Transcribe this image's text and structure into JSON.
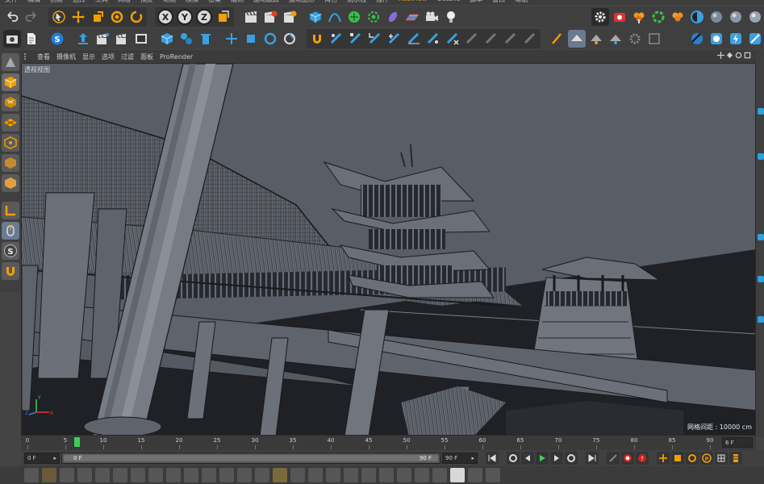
{
  "menubar": {
    "items": [
      "文件",
      "编辑",
      "创建",
      "选择",
      "工具",
      "网格",
      "捕捉",
      "动画",
      "模拟",
      "渲染",
      "雕刻",
      "运动跟踪",
      "运动图形",
      "角色",
      "流水线",
      "插件",
      "RealFlow",
      "Octane",
      "脚本",
      "窗口",
      "帮助"
    ],
    "highlight_index": 16
  },
  "viewport": {
    "menu": [
      "查看",
      "摄像机",
      "显示",
      "选项",
      "过滤",
      "面板",
      "ProRender"
    ],
    "label": "透视视图",
    "grid_readout": "网格间距 : 10000 cm",
    "colors": {
      "sky": "#585d66",
      "ground": "#1f2126",
      "geometry": "#6b7079",
      "wire": "#1a1a1a"
    }
  },
  "timeline": {
    "ticks": [
      0,
      5,
      10,
      15,
      20,
      25,
      30,
      35,
      40,
      45,
      50,
      55,
      60,
      65,
      70,
      75,
      80,
      85,
      90
    ],
    "current_frame": 6,
    "end_frame_label": "6 F",
    "max_frame": 90
  },
  "transport": {
    "start_field": "0 F",
    "range_left": "0 F",
    "range_right": "90 F",
    "end_field": "90 F"
  },
  "icons": {
    "toolbar1": [
      "undo-icon",
      "redo-icon",
      "select-arrow-icon",
      "move-icon",
      "scale-icon",
      "rotate-icon",
      "live-select-icon",
      "x-axis-icon",
      "y-axis-icon",
      "z-axis-icon",
      "coordinate-system-icon",
      "render-view-icon",
      "render-picture-viewer-icon",
      "render-settings-icon",
      "cube-icon",
      "spline-pen-icon",
      "subdivision-icon",
      "array-icon",
      "deformer-icon",
      "floor-icon",
      "camera-icon",
      "light-icon"
    ],
    "toolbar1_right": [
      "settings-icon",
      "render-red-icon",
      "flower-icon",
      "cycle-icon",
      "mushroom-icon",
      "octane-sphere-icon"
    ],
    "axis_labels": [
      "X",
      "Y",
      "Z"
    ]
  }
}
